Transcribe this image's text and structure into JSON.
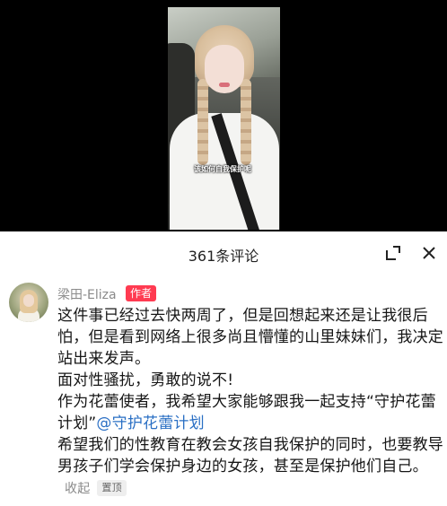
{
  "video": {
    "subtitle": "该如何自我保护呢"
  },
  "comments_panel": {
    "title": "361条评论",
    "expand_icon": "expand-icon",
    "close_icon": "close-icon"
  },
  "comment": {
    "username": "梁田-Eliza",
    "author_badge": "作者",
    "line1": "这件事已经过去快两周了，但是回想起来还是让我很后怕，但是看到网络上很多尚且懵懂的山里妹妹们，我决定站出来发声。",
    "line2": "面对性骚扰，勇敢的说不!",
    "line3": "作为花蕾使者，我希望大家能够跟我一起支持“守护花蕾计划”",
    "mention": "@守护花蕾计划",
    "line4": "希望我们的性教育在教会女孩自我保护的同时，也要教导男孩子们学会保护身边的女孩，甚至是保护他们自己。",
    "collapse": "收起",
    "pinned": "置顶"
  },
  "colors": {
    "badge_red": "#ff3b51",
    "mention_blue": "#2a6fc4",
    "muted": "#8a8a8a"
  }
}
